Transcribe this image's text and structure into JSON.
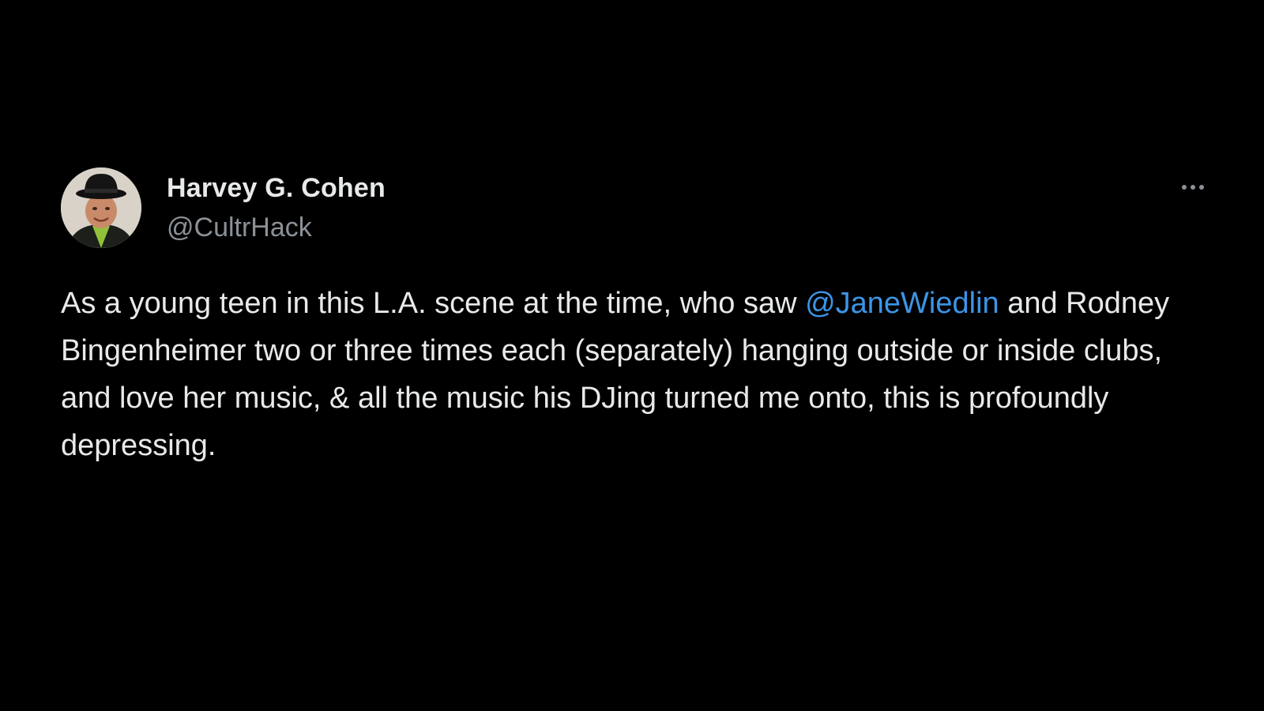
{
  "tweet": {
    "author": {
      "display_name": "Harvey G. Cohen",
      "handle": "@CultrHack",
      "avatar_icon": "profile-photo-man-in-hat"
    },
    "more_icon": "more-options-icon",
    "text_before": "As a young teen in this L.A. scene at the time, who saw ",
    "mention": "@JaneWiedlin",
    "text_after": " and Rodney Bingenheimer two or three times each (separately) hanging outside or inside clubs, and love her music, & all the music his DJing turned me onto, this is profoundly depressing."
  },
  "colors": {
    "background": "#000000",
    "primary_text": "#e7e9ea",
    "secondary_text": "#8b9197",
    "link": "#3c95e6"
  }
}
